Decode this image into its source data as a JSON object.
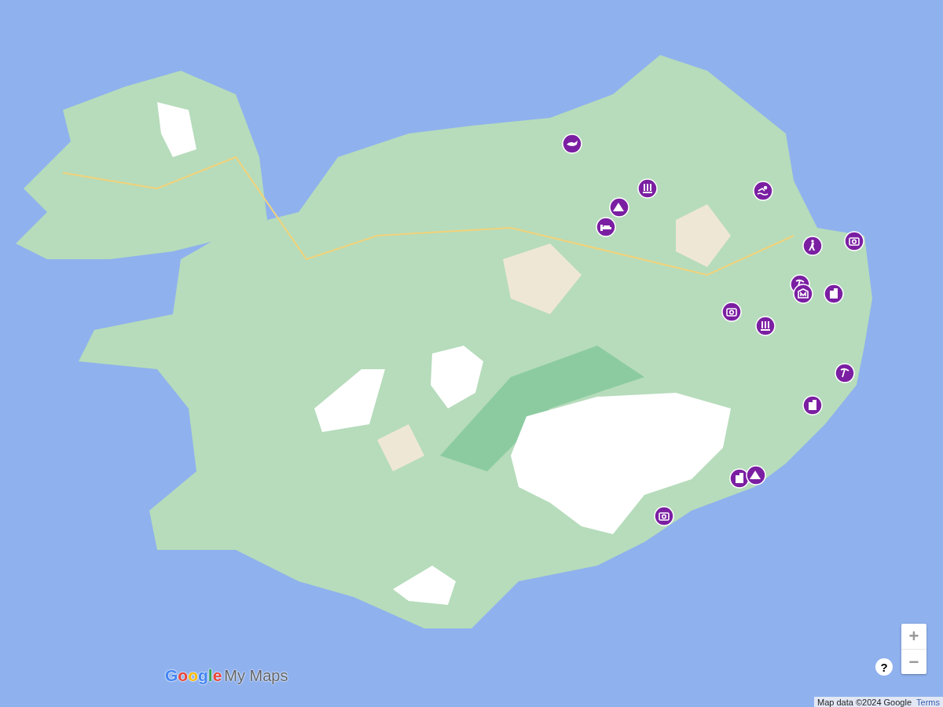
{
  "markers": [
    {
      "kind": "whale"
    },
    {
      "kind": "waterfall"
    },
    {
      "kind": "bed"
    },
    {
      "kind": "mountain"
    },
    {
      "kind": "swimmer"
    },
    {
      "kind": "hiker"
    },
    {
      "kind": "camera"
    },
    {
      "kind": "pickaxe"
    },
    {
      "kind": "museum"
    },
    {
      "kind": "building"
    },
    {
      "kind": "camera"
    },
    {
      "kind": "waterfall"
    },
    {
      "kind": "pickaxe"
    },
    {
      "kind": "building"
    },
    {
      "kind": "building"
    },
    {
      "kind": "mountain"
    },
    {
      "kind": "camera"
    }
  ],
  "logo": {
    "brand": "Google",
    "product": "My Maps"
  },
  "help_button": {
    "label": "?"
  },
  "zoom_controls": {
    "zoom_in": "+",
    "zoom_out": "−"
  },
  "attribution": {
    "text": "Map data ©2024 Google",
    "terms_link": "Terms"
  }
}
